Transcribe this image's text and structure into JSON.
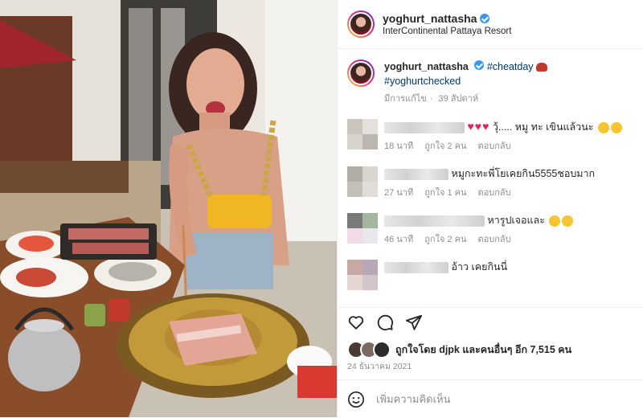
{
  "post": {
    "username": "yoghurt_nattasha",
    "location": "InterContinental Pattaya Resort"
  },
  "caption": {
    "username": "yoghurt_nattasha",
    "hashtag1": "#cheatday",
    "hashtag2": "#yoghurtchecked",
    "edited": "มีการแก้ไข",
    "time": "39 สัปดาห์"
  },
  "comments": [
    {
      "text": "วุ้..... หมู ทะ เขินแล้วนะ",
      "time": "18 นาที",
      "likes": "ถูกใจ 2 คน",
      "reply": "ตอบกลับ"
    },
    {
      "text": "หมูกะทะพี่โยเคยกิน5555ชอบมาก",
      "time": "27 นาที",
      "likes": "ถูกใจ 1 คน",
      "reply": "ตอบกลับ"
    },
    {
      "text": "หารูปเจอและ",
      "time": "46 นาที",
      "likes": "ถูกใจ 2 คน",
      "reply": "ตอบกลับ"
    },
    {
      "text": "อ้าว เคยกินนี่",
      "time": "",
      "likes": "",
      "reply": ""
    }
  ],
  "likes": {
    "text": "ถูกใจโดย djpk และคนอื่นๆ อีก 7,515 คน"
  },
  "date": "24 ธันวาคม 2021",
  "add_comment": {
    "placeholder": "เพิ่มความคิดเห็น"
  },
  "icons": [
    "heart-icon",
    "comment-icon",
    "share-icon",
    "emoji-icon",
    "verified-badge-icon"
  ],
  "colors": {
    "link": "#00376b",
    "verified": "#3897f0",
    "muted": "#8e8e8e",
    "border": "#efefef"
  }
}
